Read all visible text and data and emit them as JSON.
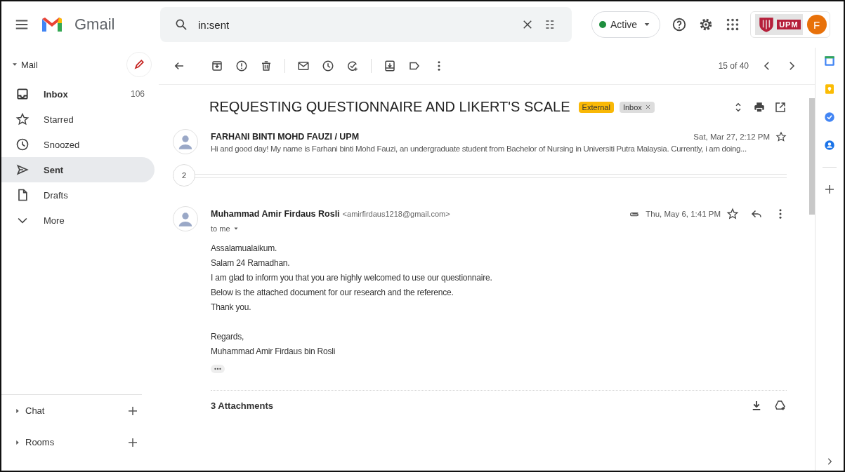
{
  "app": {
    "name": "Gmail"
  },
  "search": {
    "value": "in:sent"
  },
  "status": {
    "label": "Active",
    "color": "#1e8e3e"
  },
  "org_logo": {
    "text": "UPM"
  },
  "account": {
    "initial": "F"
  },
  "sidebar": {
    "section": "Mail",
    "expanded": true,
    "items": [
      {
        "label": "Inbox",
        "count": "106",
        "unread": true,
        "selected": false
      },
      {
        "label": "Starred",
        "unread": false,
        "selected": false
      },
      {
        "label": "Snoozed",
        "unread": false,
        "selected": false
      },
      {
        "label": "Sent",
        "unread": false,
        "selected": true
      },
      {
        "label": "Drafts",
        "unread": false,
        "selected": false
      },
      {
        "label": "More",
        "unread": false,
        "selected": false
      }
    ],
    "groups": [
      {
        "label": "Chat",
        "expanded": false
      },
      {
        "label": "Rooms",
        "expanded": false
      }
    ]
  },
  "toolbar": {
    "pager": "15 of 40"
  },
  "thread": {
    "subject": "REQUESTING QUESTIONNAIRE AND LIKERT'S SCALE",
    "labels": [
      {
        "text": "External",
        "color": "#f9b806",
        "removable": false
      },
      {
        "text": "Inbox",
        "color": "#dddddd",
        "removable": true
      }
    ],
    "collapsed": {
      "sender": "FARHANI BINTI MOHD FAUZI / UPM",
      "date": "Sat, Mar 27, 2:12 PM",
      "starred": false,
      "snippet": "Hi and good day! My name is Farhani binti Mohd Fauzi, an undergraduate student from Bachelor of Nursing in Universiti Putra Malaysia. Currently, i am doing..."
    },
    "hidden_count": "2",
    "message": {
      "sender": "Muhammad Amir Firdaus Rosli",
      "email": "<amirfirdaus1218@gmail.com>",
      "recipient": "to me",
      "date": "Thu, May 6, 1:41 PM",
      "starred": false,
      "has_attachment": true,
      "body": [
        "Assalamualaikum.",
        "Salam 24 Ramadhan.",
        "I am glad to inform you that you are highly welcomed to use our questionnaire.",
        "Below is the attached document for our research and the reference.",
        "Thank you."
      ],
      "signature": [
        "Regards,",
        "Muhammad Amir Firdaus bin Rosli"
      ]
    },
    "attachments": {
      "title": "3 Attachments"
    }
  }
}
